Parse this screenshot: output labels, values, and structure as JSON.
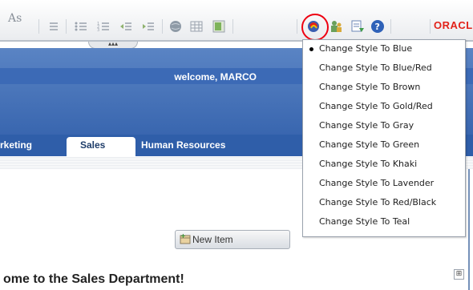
{
  "toolbar": {
    "text_style_icon": "As",
    "brand": "ORACL",
    "icons": [
      "indent-icon",
      "bullet-list-icon",
      "numbered-list-icon",
      "outdent-icon",
      "indent-more-icon",
      "globe-icon",
      "table-icon",
      "image-icon",
      "style-icon",
      "users-icon",
      "export-icon",
      "help-icon"
    ]
  },
  "header": {
    "welcome": "welcome, MARCO"
  },
  "tabs": {
    "left_partial": "rketing",
    "active": "Sales",
    "right": "Human Resources"
  },
  "content": {
    "new_item_label": "New Item",
    "heading": "ome to the Sales Department!"
  },
  "style_menu": {
    "selected_index": 0,
    "items": [
      "Change Style To Blue",
      "Change Style To Blue/Red",
      "Change Style To Brown",
      "Change Style To Gold/Red",
      "Change Style To Gray",
      "Change Style To Green",
      "Change Style To Khaki",
      "Change Style To Lavender",
      "Change Style To Red/Black",
      "Change Style To Teal"
    ]
  }
}
